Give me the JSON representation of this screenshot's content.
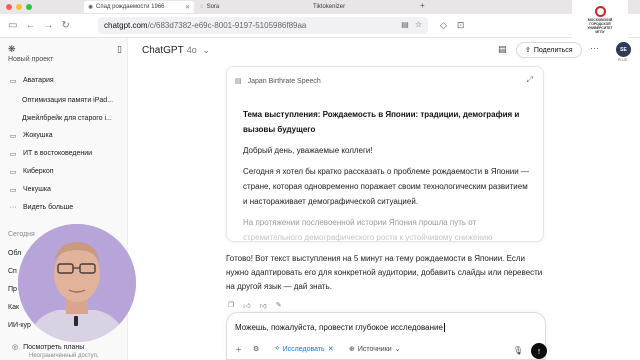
{
  "browser": {
    "tabs": [
      {
        "label": "Спад рождаемости 1966",
        "icon": "chatgpt-icon",
        "active": true
      },
      {
        "label": "Sora",
        "icon": "sora-icon",
        "active": false
      },
      {
        "label": "Tiktokenizer",
        "icon": "tiktokenizer-icon",
        "active": false
      }
    ],
    "new_tab": "+",
    "url_host": "chatgpt.com",
    "url_path": "/c/683d7382-e69c-8001-9197-5105986f89aa",
    "traffic_colors": [
      "#ff5f57",
      "#febc2e",
      "#28c840"
    ]
  },
  "university_logo": {
    "lines": [
      "МОСКОВСКИЙ",
      "ГОРОДСКОЙ",
      "УНИВЕРСИТЕТ",
      "МГПУ"
    ],
    "color": "#d0242b"
  },
  "sidebar": {
    "top_partial": "Новый проект",
    "items": [
      {
        "label": "Аватария",
        "icon": "folder-icon",
        "sub": false
      },
      {
        "label": "Оптимизация памяти iPad...",
        "icon": "",
        "sub": true
      },
      {
        "label": "Джейлбрейк для старого i...",
        "icon": "",
        "sub": true
      },
      {
        "label": "Жокушка",
        "icon": "folder-icon",
        "sub": false
      },
      {
        "label": "ИТ в востоковедении",
        "icon": "folder-icon",
        "sub": false
      },
      {
        "label": "Киберкоп",
        "icon": "folder-icon",
        "sub": false
      },
      {
        "label": "Чекушка",
        "icon": "folder-icon",
        "sub": false
      },
      {
        "label": "Видеть больше",
        "icon": "more-icon",
        "sub": false
      }
    ],
    "section_label": "Сегодня",
    "partial_items": [
      "Обл",
      "Сп",
      "Пр",
      "Как",
      "ИИ-кур"
    ],
    "plans": {
      "title": "Посмотреть планы",
      "subtitle": "Неограниченный доступ,"
    }
  },
  "header": {
    "model_name": "ChatGPT",
    "model_version": "4o",
    "share_label": "Поделиться",
    "avatar_initials": "SE",
    "plus_tag": "PLUS"
  },
  "canvas": {
    "title": "Japan Birthrate Speech",
    "heading": "Тема выступления: Рождаемость в Японии: традиции, демография и вызовы будущего",
    "greeting": "Добрый день, уважаемые коллеги!",
    "paragraph1": "Сегодня я хотел бы кратко рассказать о проблеме рождаемости в Японии — стране, которая одновременно поражает своим технологическим развитием и настораживает демографической ситуацией.",
    "paragraph2a": "На протяжении послевоенной истории Япония прошла путь от",
    "paragraph2b": "стремительного демографического роста к устойчивому снижению"
  },
  "reply": {
    "text": "Готово! Вот текст выступления на 5 минут на тему рождаемости в Японии. Если нужно адаптировать его для конкретной аудитории, добавить слайды или перевести на другой язык — дай знать."
  },
  "composer": {
    "input_value": "Можешь, пожалуйста, провести глубокое исследование",
    "research_label": "Исследовать",
    "sources_label": "Источники"
  }
}
